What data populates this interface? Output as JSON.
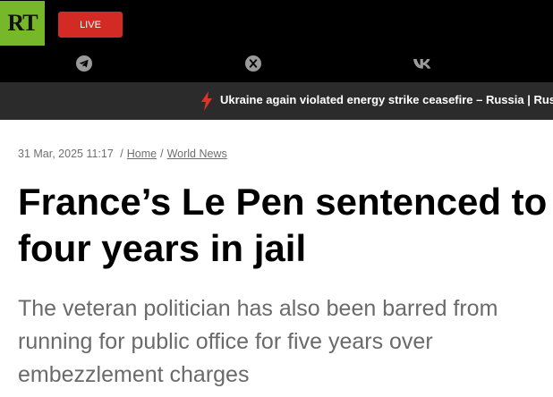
{
  "header": {
    "logo_text": "RT",
    "live_label": "LIVE",
    "colors": {
      "logo_bg": "#77b82a",
      "live_bg": "#d42a24",
      "bar_bg": "#000000"
    },
    "social_icons": [
      "telegram-icon",
      "x-icon",
      "vk-icon"
    ]
  },
  "ticker": {
    "text": "Ukraine again violated energy strike ceasefire – Russia | Russia"
  },
  "article": {
    "date": "31 Mar, 2025 11:17",
    "separator": "/",
    "breadcrumb": [
      "Home",
      "World News"
    ],
    "title": "France’s Le Pen sentenced to four years in jail",
    "summary": "The veteran politician has also been barred from running for public office for five years over embezzlement charges"
  }
}
